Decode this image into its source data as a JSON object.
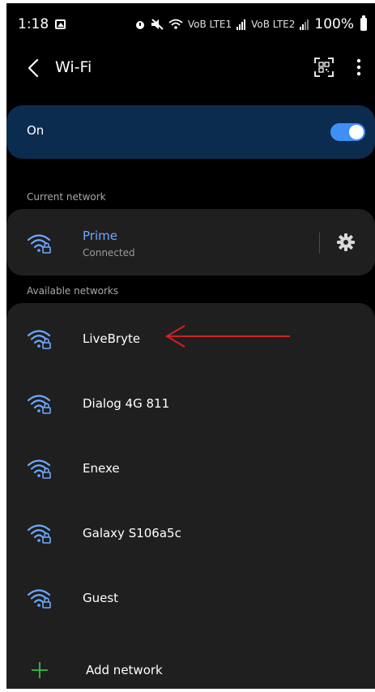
{
  "status_bar": {
    "time": "1:18",
    "signal_text_1": "VoB LTE1",
    "signal_text_2": "VoB LTE2",
    "battery": "100%"
  },
  "header": {
    "title": "Wi-Fi",
    "back_icon": "chevron-left-icon",
    "qr_icon": "qr-code-icon",
    "more_icon": "more-vertical-icon"
  },
  "wifi_toggle": {
    "label": "On",
    "state": true,
    "track_color": "#3f8ff5"
  },
  "current_network": {
    "section_label": "Current network",
    "name": "Prime",
    "status": "Connected",
    "settings_icon": "gear-icon"
  },
  "available_networks": {
    "section_label": "Available networks",
    "items": [
      {
        "name": "LiveBryte"
      },
      {
        "name": "Dialog 4G 811"
      },
      {
        "name": "Enexe"
      },
      {
        "name": "Galaxy S106a5c"
      },
      {
        "name": "Guest"
      }
    ],
    "add_label": "Add network",
    "add_icon_color": "#2ec04a"
  },
  "colors": {
    "accent_blue": "#6fa8ff",
    "toggle_card": "#0b2c4f",
    "card_bg": "#1f1f1f",
    "arrow_red": "#d42020"
  }
}
